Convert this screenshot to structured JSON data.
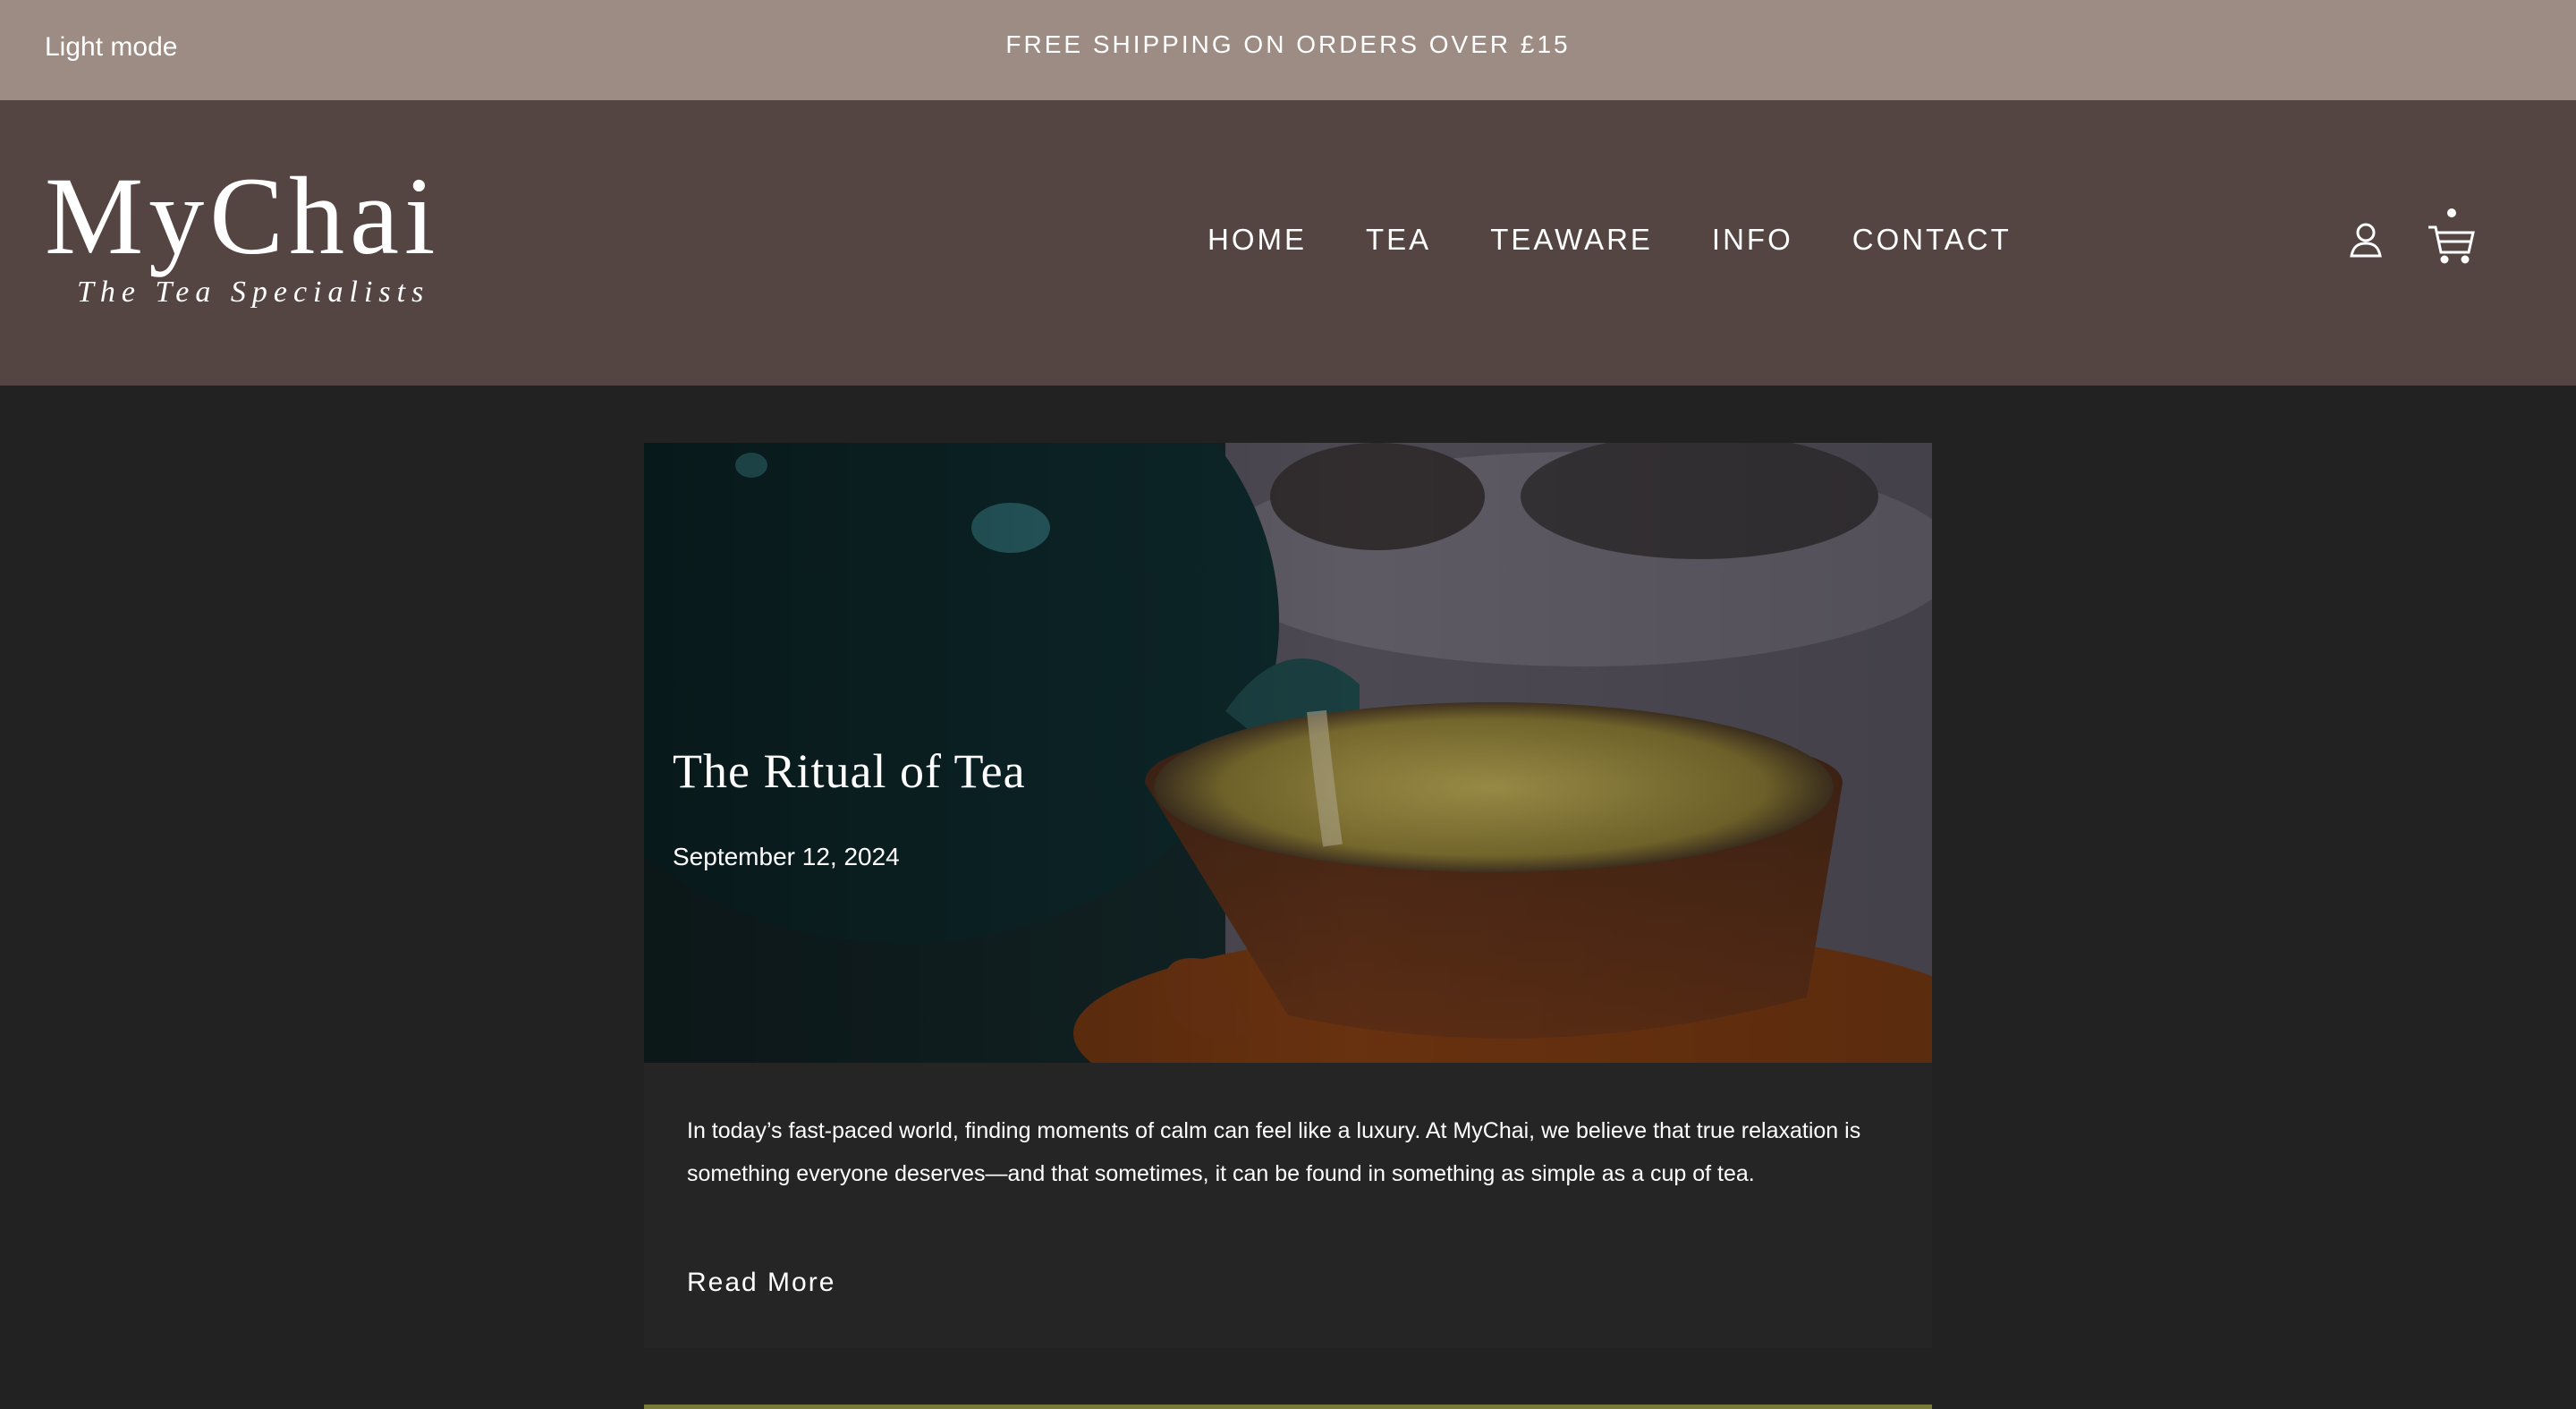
{
  "announcement": {
    "mode_toggle": "Light mode",
    "text": "FREE SHIPPING ON ORDERS OVER £15"
  },
  "header": {
    "logo_title": "MyChai",
    "logo_subtitle": "The Tea Specialists",
    "nav": [
      "HOME",
      "TEA",
      "TEAWARE",
      "INFO",
      "CONTACT"
    ],
    "icons": [
      "account-icon",
      "cart-icon"
    ]
  },
  "article": {
    "title": "The Ritual of Tea",
    "date": "September 12, 2024",
    "excerpt": "In today’s fast-paced world, finding moments of calm can feel like a luxury. At MyChai, we believe that true relaxation is something everyone deserves—and that sometimes, it can be found in something as simple as a cup of tea.",
    "read_more": "Read More"
  },
  "colors": {
    "announcement_bg": "#9d8c83",
    "header_bg": "#544542",
    "page_bg": "#222222",
    "card_bg": "#252525"
  }
}
